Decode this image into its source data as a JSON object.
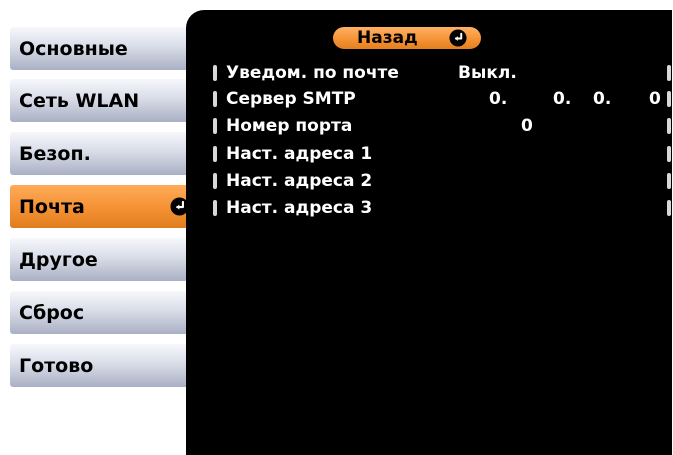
{
  "sidebar": {
    "items": [
      {
        "label": "Основные"
      },
      {
        "label": "Сеть WLAN"
      },
      {
        "label": "Безоп."
      },
      {
        "label": "Почта"
      },
      {
        "label": "Другое"
      },
      {
        "label": "Сброс"
      },
      {
        "label": "Готово"
      }
    ]
  },
  "main": {
    "back_label": "Назад",
    "rows": [
      {
        "label": "Уведом. по почте",
        "value": "Выкл."
      },
      {
        "label": "Сервер SMTP",
        "octets": [
          "0.",
          "0.",
          "0.",
          "0"
        ]
      },
      {
        "label": "Номер порта",
        "value": "0"
      },
      {
        "label": "Наст. адреса 1"
      },
      {
        "label": "Наст. адреса 2"
      },
      {
        "label": "Наст. адреса 3"
      }
    ]
  },
  "colors": {
    "accent_orange": "#f49133",
    "menu_gradient_top": "#f7f8fc",
    "menu_gradient_bottom": "#aab0c4",
    "panel_background": "#000000",
    "text_light": "#ffffff"
  },
  "icons": {
    "enter": "enter-icon"
  }
}
